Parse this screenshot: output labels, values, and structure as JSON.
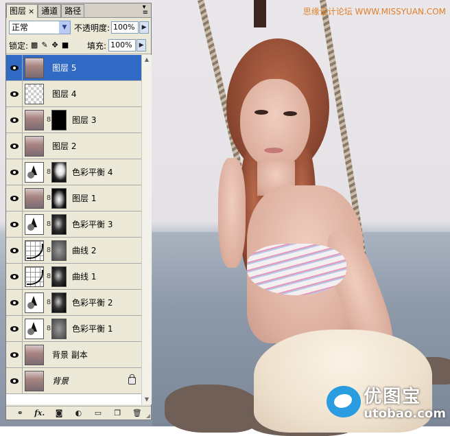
{
  "watermark": {
    "top_left_text": "思缘设计论坛",
    "top_site": "WWW.MISSYUAN.COM",
    "logo_cn": "优图宝",
    "logo_en": "utobao.com"
  },
  "panel": {
    "tabs": [
      {
        "label": "图层",
        "active": true,
        "close": "×"
      },
      {
        "label": "通道"
      },
      {
        "label": "路径"
      }
    ],
    "blend_mode": "正常",
    "opacity_label": "不透明度:",
    "opacity_value": "100%",
    "lock_label": "锁定:",
    "fill_label": "填充:",
    "fill_value": "100%",
    "layers": [
      {
        "name": "图层 5",
        "thumb": "photo",
        "selected": true
      },
      {
        "name": "图层 4",
        "thumb": "transparent"
      },
      {
        "name": "图层 3",
        "thumb": "photo",
        "mask": "black"
      },
      {
        "name": "图层 2",
        "thumb": "photo"
      },
      {
        "name": "色彩平衡 4",
        "thumb": "color-balance",
        "mask": "white-shape"
      },
      {
        "name": "图层 1",
        "thumb": "photo",
        "mask": "bw-shape"
      },
      {
        "name": "色彩平衡 3",
        "thumb": "color-balance",
        "mask": "dark"
      },
      {
        "name": "曲线 2",
        "thumb": "curves",
        "mask": "grey"
      },
      {
        "name": "曲线 1",
        "thumb": "curves",
        "mask": "dark"
      },
      {
        "name": "色彩平衡 2",
        "thumb": "color-balance",
        "mask": "dark"
      },
      {
        "name": "色彩平衡 1",
        "thumb": "color-balance",
        "mask": "grey"
      },
      {
        "name": "背景 副本",
        "thumb": "photo"
      },
      {
        "name": "背景",
        "thumb": "photo",
        "italic": true,
        "locked": true
      }
    ],
    "bottom_buttons": [
      "link-layers-icon",
      "fx-icon",
      "add-mask-icon",
      "new-adjustment-icon",
      "new-group-icon",
      "new-layer-icon",
      "delete-layer-icon"
    ],
    "fx_label": "fx."
  },
  "colors": {
    "selection": "#316ac5",
    "panel_bg": "#ece9d8",
    "watermark": "#e27e2a",
    "logo_blue": "#2a9ce0"
  }
}
